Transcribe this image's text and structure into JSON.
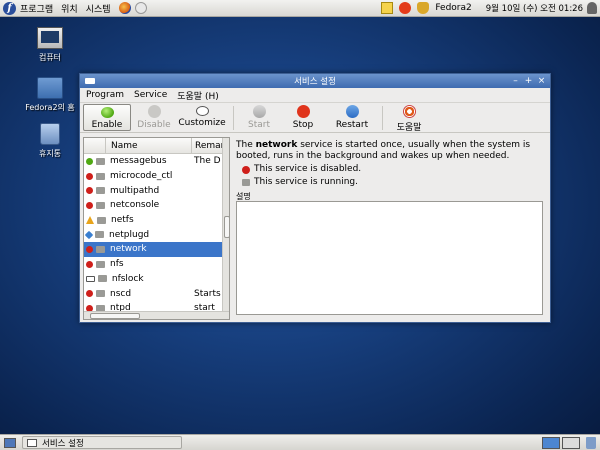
{
  "top_panel": {
    "menus": [
      "프로그램",
      "위치",
      "시스템"
    ],
    "username": "Fedora2",
    "clock": "9월 10일 (수) 오전 01:26"
  },
  "desktop": {
    "icons": [
      {
        "label": "컴퓨터",
        "icon": "computer-icon"
      },
      {
        "label": "Fedora2의 홈",
        "icon": "home-folder-icon"
      },
      {
        "label": "휴지통",
        "icon": "trash-icon"
      }
    ]
  },
  "window": {
    "title": "서비스 설정",
    "menubar": [
      "Program",
      "Service",
      "도움말 (H)"
    ],
    "toolbar": {
      "enable": "Enable",
      "disable": "Disable",
      "customize": "Customize",
      "start": "Start",
      "stop": "Stop",
      "restart": "Restart",
      "help": "도움말"
    },
    "list": {
      "headers": {
        "name": "Name",
        "remark": "Remar"
      },
      "rows": [
        {
          "status": "green",
          "name": "messagebus",
          "remark": "The D-"
        },
        {
          "status": "red",
          "name": "microcode_ctl",
          "remark": ""
        },
        {
          "status": "red",
          "name": "multipathd",
          "remark": ""
        },
        {
          "status": "red",
          "name": "netconsole",
          "remark": ""
        },
        {
          "status": "warn",
          "name": "netfs",
          "remark": ""
        },
        {
          "status": "diamond",
          "name": "netplugd",
          "remark": ""
        },
        {
          "status": "red",
          "name": "network",
          "remark": ""
        },
        {
          "status": "red",
          "name": "nfs",
          "remark": ""
        },
        {
          "status": "box",
          "name": "nfslock",
          "remark": ""
        },
        {
          "status": "red",
          "name": "nscd",
          "remark": "Starts"
        },
        {
          "status": "red",
          "name": "ntpd",
          "remark": "start"
        }
      ],
      "selected_index": 6
    },
    "detail": {
      "prefix": "The ",
      "service_name": "network",
      "suffix": " service is started once, usually when the system is booted, runs in the background and wakes up when needed.",
      "status_disabled": "This service is disabled.",
      "status_running": "This service is running.",
      "description_label": "설명"
    }
  },
  "bottom_panel": {
    "task": "서비스 설정"
  }
}
